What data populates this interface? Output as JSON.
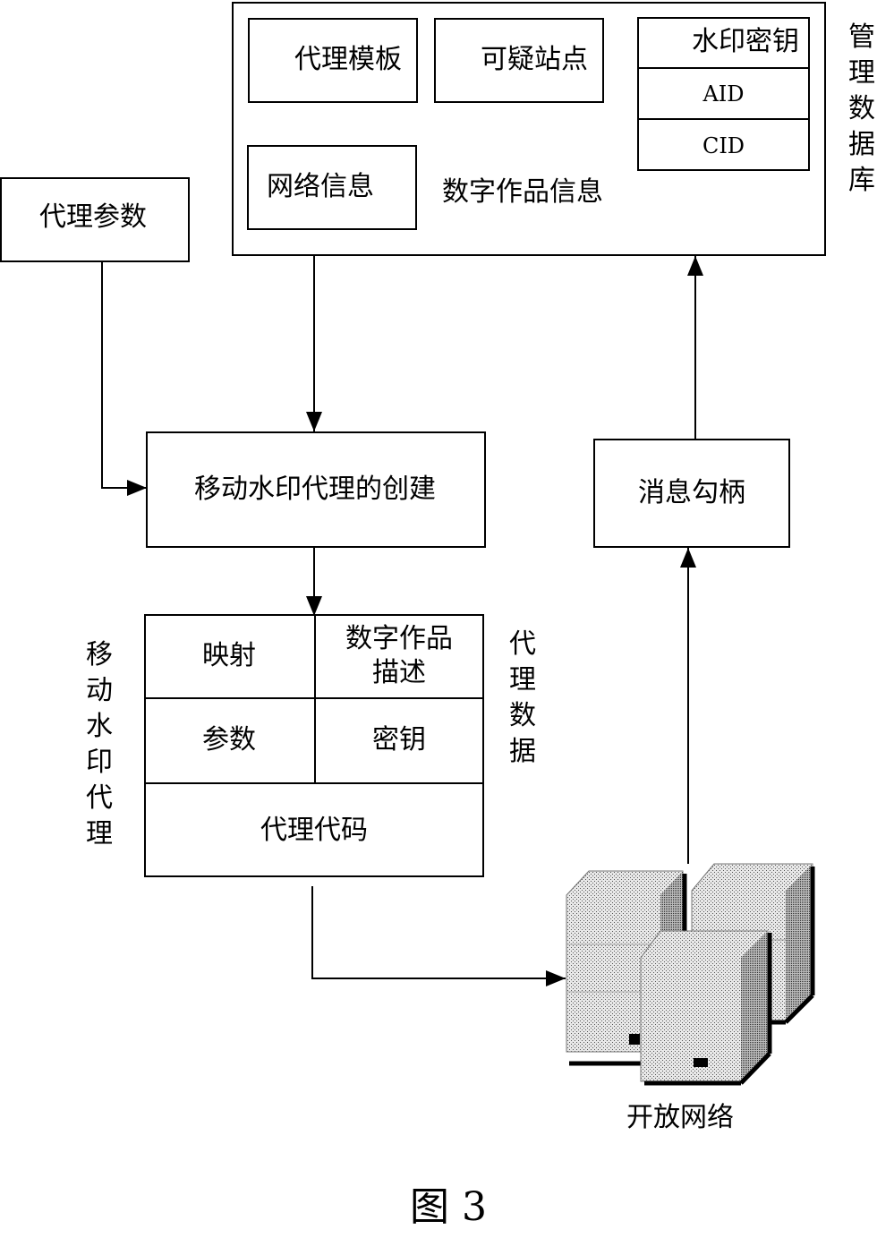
{
  "database": {
    "label": "管理数据库",
    "agent_template": "代理模板",
    "suspicious_sites": "可疑站点",
    "network_info": "网络信息",
    "digital_work_info": "数字作品信息",
    "key_stack": [
      "水印密钥",
      "AID",
      "CID"
    ]
  },
  "agent_params": "代理参数",
  "agent_creation": "移动水印代理的创建",
  "message_hook": "消息勾柄",
  "mobile_agent": {
    "label": "移动水印代理",
    "data_label": "代理数据",
    "cells": {
      "mapping": "映射",
      "work_description": "数字作品描述",
      "params": "参数",
      "key": "密钥",
      "code": "代理代码"
    }
  },
  "open_network": "开放网络",
  "figure_caption": "图 3"
}
